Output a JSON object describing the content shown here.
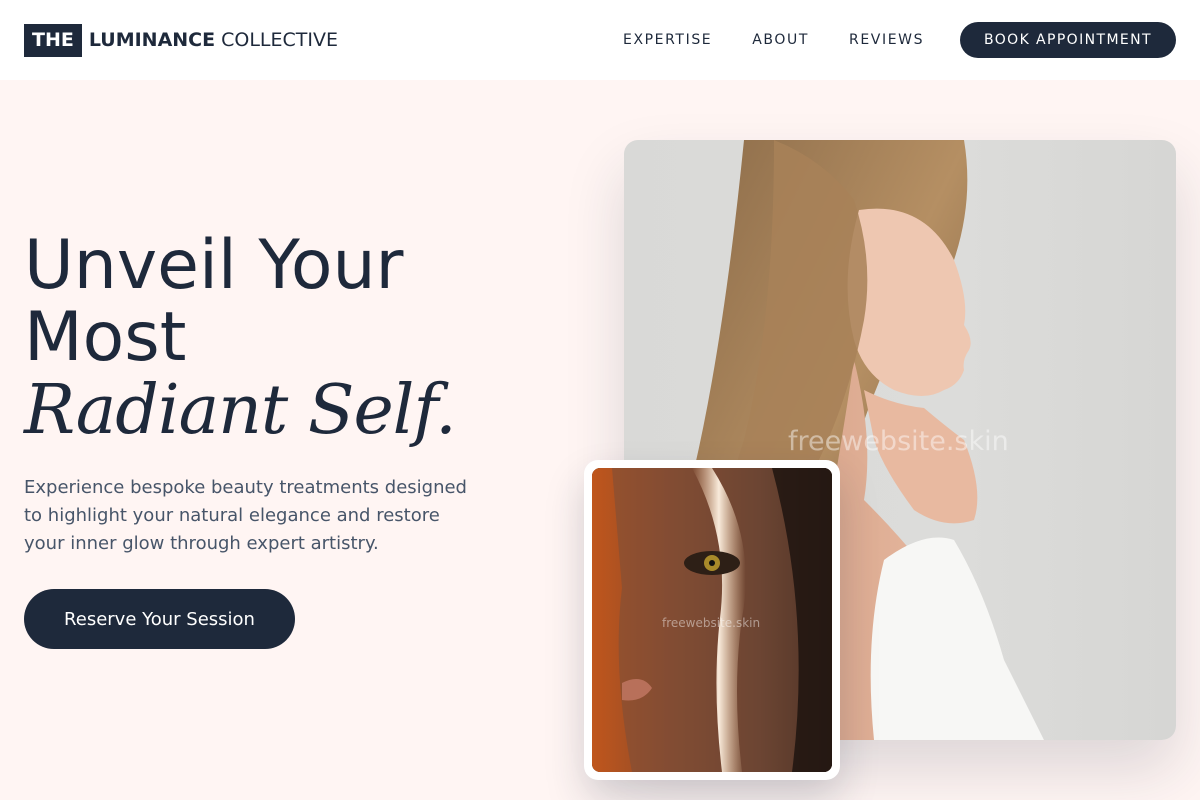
{
  "brand": {
    "prefix": "THE",
    "name": "LUMINANCE",
    "suffix": "COLLECTIVE"
  },
  "nav": {
    "items": [
      "EXPERTISE",
      "ABOUT",
      "REVIEWS"
    ],
    "cta": "BOOK APPOINTMENT"
  },
  "hero": {
    "title_line1": "Unveil Your",
    "title_line2": "Most",
    "title_italic": "Radiant Self.",
    "subtitle": "Experience bespoke beauty treatments designed to highlight your natural elegance and restore your inner glow through expert artistry.",
    "cta": "Reserve Your Session"
  },
  "images": {
    "main_watermark": "freewebsite.skin",
    "small_watermark": "freewebsite.skin"
  },
  "colors": {
    "primary": "#1e293b",
    "background": "#fff5f3",
    "text_muted": "#475569"
  }
}
